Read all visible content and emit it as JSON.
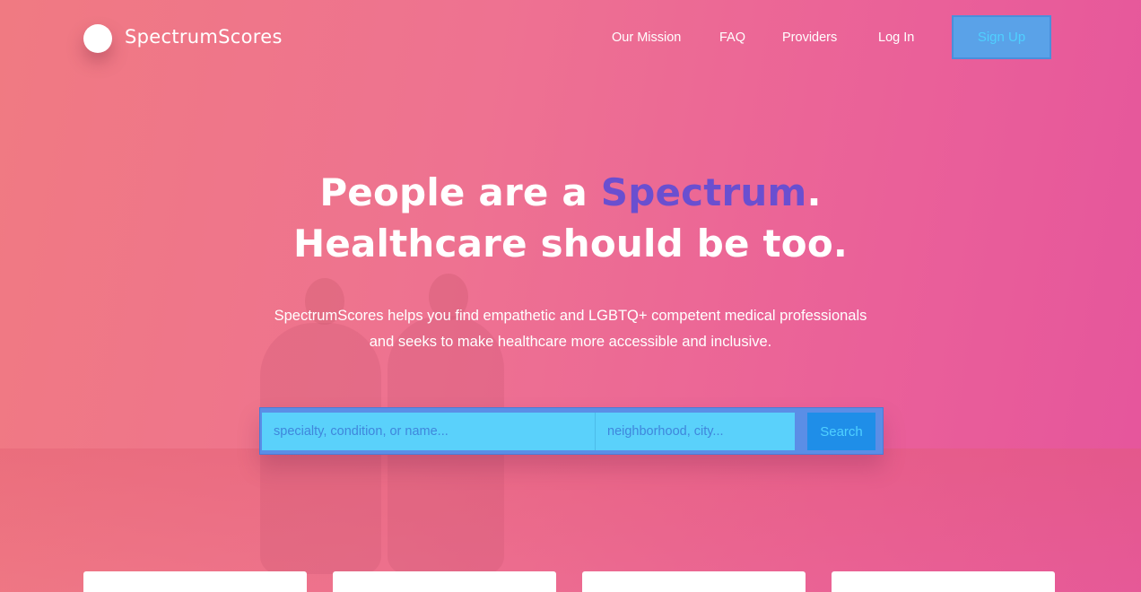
{
  "brand": {
    "name": "SpectrumScores"
  },
  "nav": {
    "items": [
      {
        "label": "Our Mission"
      },
      {
        "label": "FAQ"
      },
      {
        "label": "Providers"
      },
      {
        "label": "Log In"
      }
    ],
    "signup_label": "Sign Up"
  },
  "hero": {
    "line1_prefix": "People are a ",
    "line1_accent": "Spectrum",
    "line1_suffix": ".",
    "line2": "Healthcare should be too.",
    "subtitle_line1": "SpectrumScores helps you find empathetic and LGBTQ+ competent medical professionals",
    "subtitle_line2": "and seeks to make healthcare more accessible and inclusive."
  },
  "search": {
    "query_placeholder": "specialty, condition, or name...",
    "location_placeholder": "neighborhood, city...",
    "button_label": "Search"
  },
  "colors": {
    "accent": "#6a4fd0",
    "signup_bg": "#5aa2e8",
    "search_field": "#5ad1fb",
    "search_button": "#1f8ee8"
  }
}
